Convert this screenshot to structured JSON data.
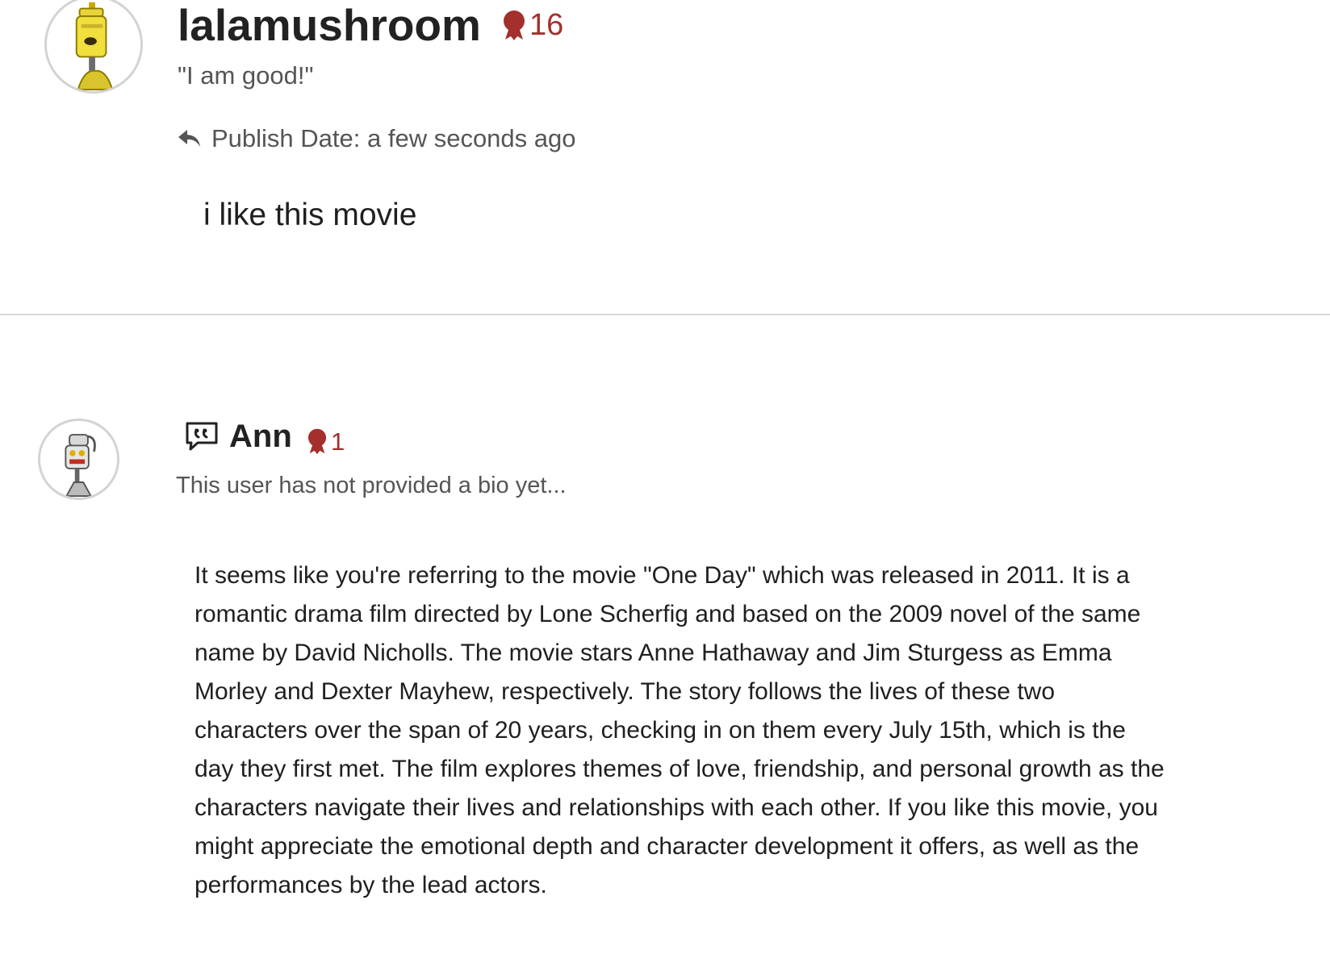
{
  "comments": [
    {
      "username": "lalamushroom",
      "reputation": "16",
      "bio": "\"I am good!\"",
      "publish_label": "Publish Date: a few seconds ago",
      "text": "i like this movie",
      "avatar_icon": "yellow-robot-avatar-icon",
      "meta_icon": "reply-arrow-icon",
      "badge_icon": "award-ribbon-icon"
    },
    {
      "username": "Ann",
      "reputation": "1",
      "bio": "This user has not provided a bio yet...",
      "text": "It seems like you're referring to the movie \"One Day\" which was released in 2011. It is a romantic drama film directed by Lone Scherfig and based on the 2009 novel of the same name by David Nicholls. The movie stars Anne Hathaway and Jim Sturgess as Emma Morley and Dexter Mayhew, respectively. The story follows the lives of these two characters over the span of 20 years, checking in on them every July 15th, which is the day they first met. The film explores themes of love, friendship, and personal growth as the characters navigate their lives and relationships with each other. If you like this movie, you might appreciate the emotional depth and character development it offers, as well as the performances by the lead actors.",
      "avatar_icon": "grey-robot-avatar-icon",
      "name_icon": "quote-speech-bubble-icon",
      "badge_icon": "award-ribbon-icon"
    }
  ],
  "colors": {
    "badge": "#a3302c",
    "divider": "#d6d6d6",
    "muted_text": "#555555"
  }
}
